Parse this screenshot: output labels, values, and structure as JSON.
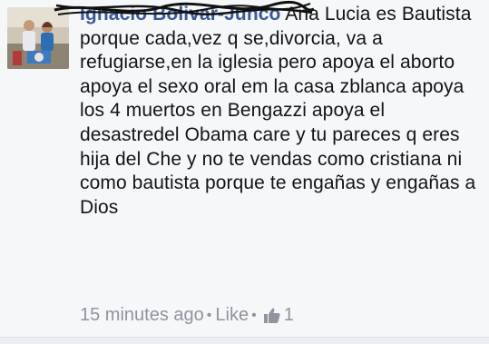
{
  "comment": {
    "author": "Ignacio Bolivar-Junco",
    "text": "Ana Lucia es Bautista porque cada,vez q se,divorcia, va a refugiarse,en la iglesia pero apoya el aborto apoya el sexo oral em la casa zblanca apoya los 4 muertos en Bengazzi apoya el desastredel Obama care y tu pareces q eres hija del Che y no te vendas como cristiana ni como bautista porque te engañas y engañas a Dios",
    "timestamp": "15 minutes ago",
    "like_label": "Like",
    "like_count": "1"
  },
  "icons": {
    "like": "thumbs-up-icon",
    "avatar": "profile-photo"
  },
  "colors": {
    "author": "#3b5998",
    "meta": "#90949c",
    "text": "#141414",
    "background": "#f6f7f9"
  }
}
